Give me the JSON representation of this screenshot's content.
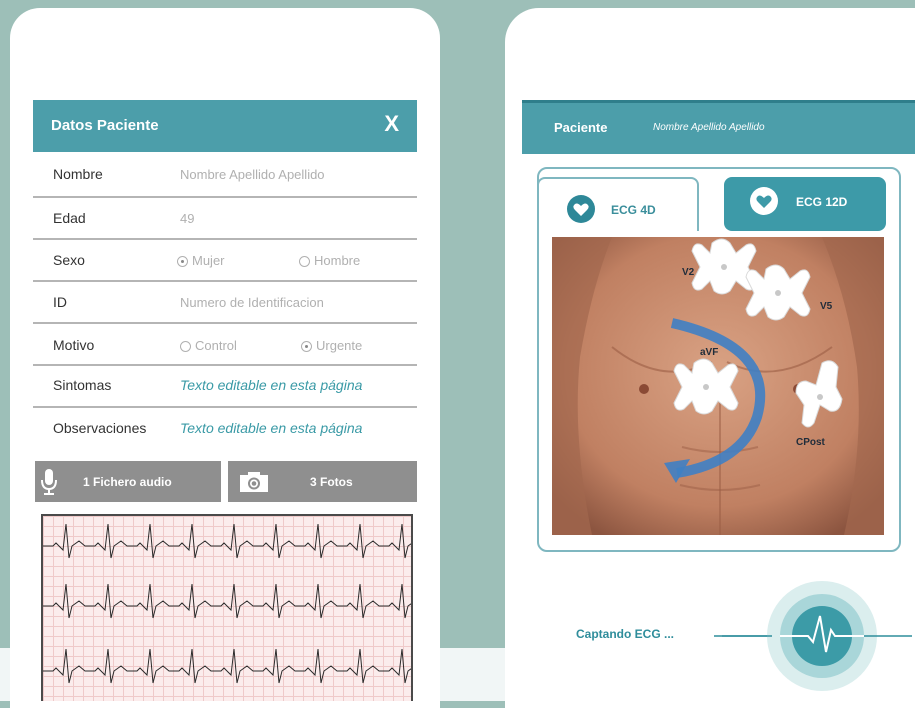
{
  "form": {
    "title": "Datos Paciente",
    "close_label": "X",
    "fields": {
      "nombre": {
        "label": "Nombre",
        "placeholder": "Nombre  Apellido  Apellido"
      },
      "edad": {
        "label": "Edad",
        "value": "49"
      },
      "sexo": {
        "label": "Sexo",
        "option_1": "Mujer",
        "option_2": "Hombre",
        "selected": "Mujer"
      },
      "id": {
        "label": "ID",
        "placeholder": "Numero de Identificacion"
      },
      "motivo": {
        "label": "Motivo",
        "option_1": "Control",
        "option_2": "Urgente",
        "selected": "Urgente"
      },
      "sintomas": {
        "label": "Sintomas",
        "value": "Texto editable en esta página"
      },
      "observaciones": {
        "label": "Observaciones",
        "value": "Texto editable en esta página"
      }
    },
    "audio_button": {
      "label": "1 Fichero audio",
      "icon": "microphone-icon"
    },
    "photos_button": {
      "label": "3 Fotos",
      "icon": "camera-icon"
    }
  },
  "ecg_app": {
    "patient_label": "Paciente",
    "patient_name": "Nombre Apellido Apellido",
    "tabs": [
      {
        "label": "ECG 4D",
        "icon": "heart-icon",
        "active": true
      },
      {
        "label": "ECG 12D",
        "icon": "heart-icon",
        "active": false
      }
    ],
    "electrodes": [
      "V2",
      "V5",
      "aVF",
      "CPost"
    ],
    "capture_label": "Captando ECG ...",
    "capture_icon": "heartbeat-icon"
  },
  "colors": {
    "background": "#9dbfb8",
    "header": "#4c9eaa",
    "accent": "#2e8898",
    "button_gray": "#8f8f8f",
    "arrow_blue": "#3f7fc4"
  }
}
